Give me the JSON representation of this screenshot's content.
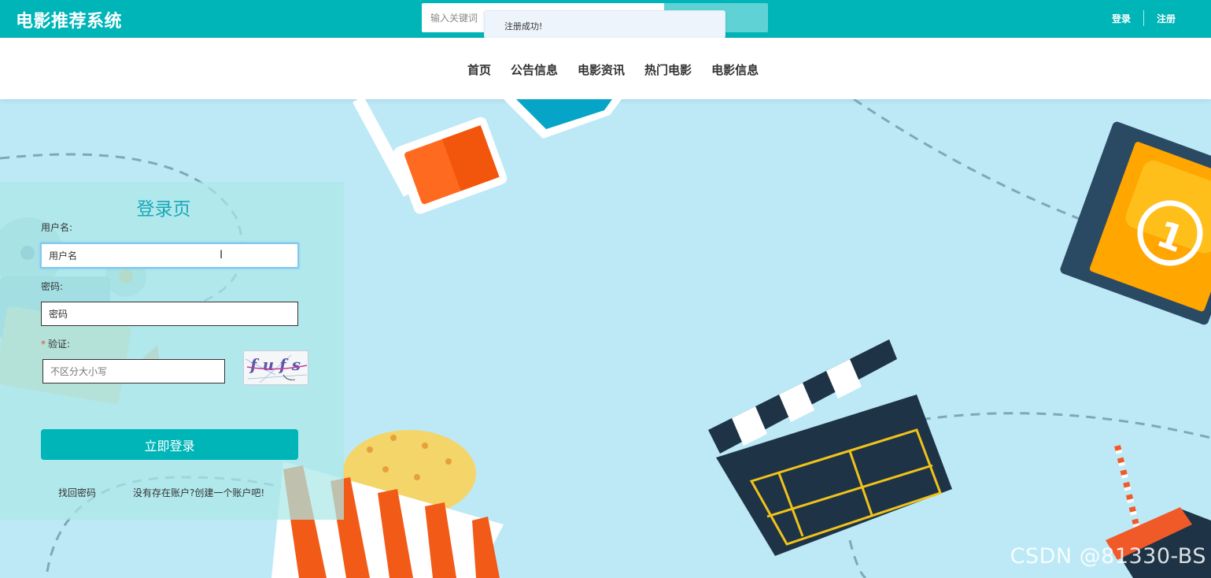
{
  "header": {
    "brand": "电影推荐系统",
    "search_placeholder": "输入关键词",
    "toast": "注册成功!",
    "links": {
      "login": "登录",
      "register": "注册"
    }
  },
  "nav": {
    "items": [
      "首页",
      "公告信息",
      "电影资讯",
      "热门电影",
      "电影信息"
    ]
  },
  "login": {
    "title": "登录页",
    "username_label": "用户名:",
    "username_value": "用户名",
    "password_label": "密码:",
    "password_value": "密码",
    "captcha_label": "验证:",
    "captcha_required_mark": "*",
    "captcha_placeholder": "不区分大小写",
    "captcha_text": "fufs",
    "submit": "立即登录",
    "forgot": "找回密码",
    "create_account": "没有存在账户?创建一个账户吧!"
  },
  "watermark": "CSDN @81330-BS",
  "colors": {
    "primary": "#00b5b8",
    "background": "#bde9f6"
  }
}
